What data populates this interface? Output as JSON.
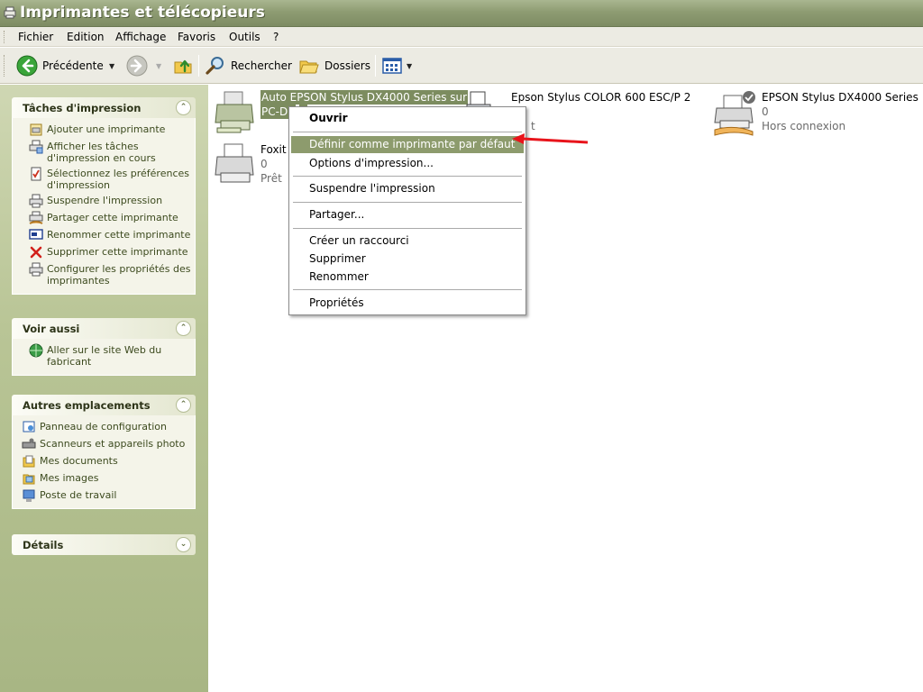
{
  "window": {
    "title": "Imprimantes et télécopieurs"
  },
  "menubar": {
    "items": [
      "Fichier",
      "Edition",
      "Affichage",
      "Favoris",
      "Outils",
      "?"
    ]
  },
  "toolbar": {
    "back_label": "Précédente",
    "search_label": "Rechercher",
    "folders_label": "Dossiers"
  },
  "sidebar": {
    "tasks": {
      "title": "Tâches d'impression",
      "items": [
        "Ajouter une imprimante",
        "Afficher les tâches d'impression en cours",
        "Sélectionnez les préférences d'impression",
        "Suspendre l'impression",
        "Partager cette imprimante",
        "Renommer cette imprimante",
        "Supprimer cette imprimante",
        "Configurer les propriétés des imprimantes"
      ]
    },
    "see_also": {
      "title": "Voir aussi",
      "items": [
        "Aller sur le site Web du fabricant"
      ]
    },
    "other_places": {
      "title": "Autres emplacements",
      "items": [
        "Panneau de configuration",
        "Scanneurs et appareils photo",
        "Mes documents",
        "Mes images",
        "Poste de travail"
      ]
    },
    "details": {
      "title": "Détails"
    }
  },
  "printers": [
    {
      "name": "Auto EPSON Stylus DX4000 Series sur",
      "name2": "PC-DE",
      "count": "0",
      "status": ""
    },
    {
      "name": "Epson Stylus COLOR 600 ESC/P 2",
      "count": "",
      "status": "t"
    },
    {
      "name": "EPSON Stylus DX4000 Series",
      "count": "0",
      "status": "Hors connexion"
    },
    {
      "name": "Foxit",
      "count": "0",
      "status": "Prêt"
    }
  ],
  "context_menu": {
    "items": [
      "Ouvrir",
      "Définir comme imprimante par défaut",
      "Options d'impression...",
      "Suspendre l'impression",
      "Partager...",
      "Créer un raccourci",
      "Supprimer",
      "Renommer",
      "Propriétés"
    ]
  },
  "colors": {
    "titlebar": "#8e9c72",
    "sidebar": "#b9c596",
    "menu_highlight": "#8d9b6d",
    "selection": "#7c8c5f",
    "arrow": "#e8141b"
  },
  "icons": {
    "window": "printer-folder-icon",
    "back": "back-arrow-icon",
    "forward": "forward-arrow-icon",
    "up": "folder-up-icon",
    "search": "magnifier-icon",
    "folders": "folders-icon",
    "views": "views-icon"
  }
}
